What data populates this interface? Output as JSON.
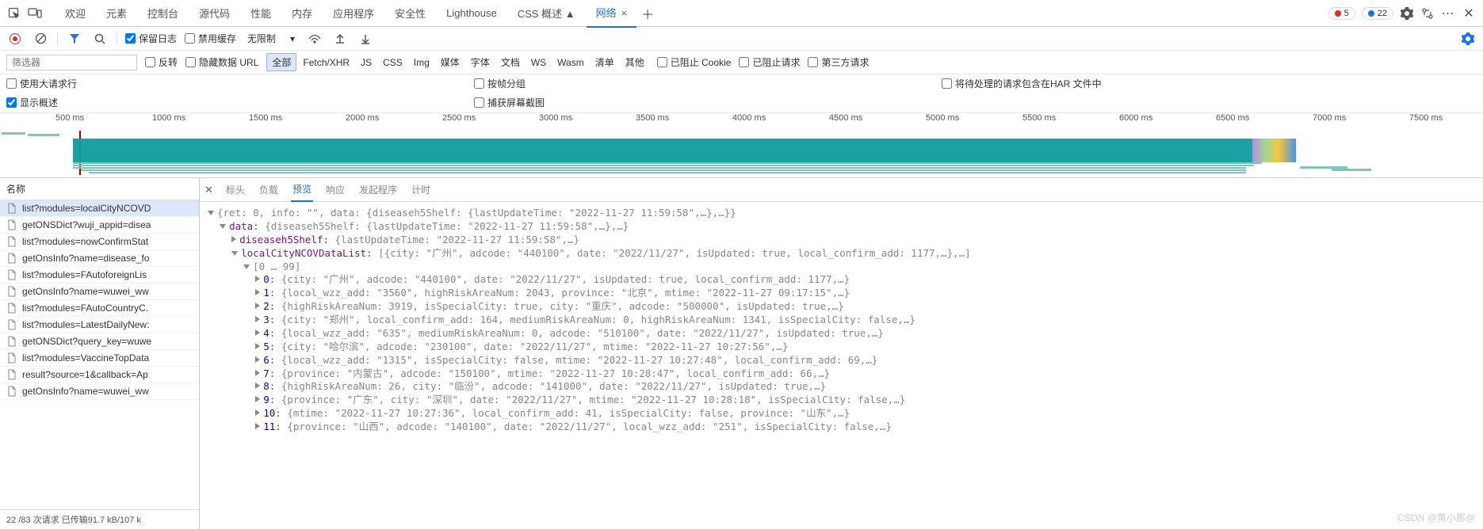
{
  "tabs": [
    "欢迎",
    "元素",
    "控制台",
    "源代码",
    "性能",
    "内存",
    "应用程序",
    "安全性",
    "Lighthouse",
    "CSS 概述 ▲",
    "网络"
  ],
  "activeTab": "网络",
  "errorCount": "5",
  "warnCount": "22",
  "toolbar": {
    "preserveLog": "保留日志",
    "disableCache": "禁用缓存",
    "throttling": "无限制"
  },
  "filter": {
    "placeholder": "筛选器",
    "invert": "反转",
    "hideDataUrl": "隐藏数据 URL",
    "types": [
      "全部",
      "Fetch/XHR",
      "JS",
      "CSS",
      "Img",
      "媒体",
      "字体",
      "文档",
      "WS",
      "Wasm",
      "清单",
      "其他"
    ],
    "blocked3p": "第三方请求",
    "blockedCookies": "已阻止 Cookie",
    "blockedReq": "已阻止请求"
  },
  "opts": {
    "bigRows": "使用大请求行",
    "groupByFrame": "按帧分组",
    "harIncludePending": "将待处理的请求包含在HAR 文件中",
    "showOverview": "显示概述",
    "captureScreens": "捕获屏幕截图"
  },
  "ruler": [
    "500 ms",
    "1000 ms",
    "1500 ms",
    "2000 ms",
    "2500 ms",
    "3000 ms",
    "3500 ms",
    "4000 ms",
    "4500 ms",
    "5000 ms",
    "5500 ms",
    "6000 ms",
    "6500 ms",
    "7000 ms",
    "7500 ms"
  ],
  "left": {
    "header": "名称",
    "items": [
      "list?modules=localCityNCOVD",
      "getONSDict?wuji_appid=disea",
      "list?modules=nowConfirmStat",
      "getOnsInfo?name=disease_fo",
      "list?modules=FAutoforeignLis",
      "getOnsInfo?name=wuwei_ww",
      "list?modules=FAutoCountryC.",
      "list?modules=LatestDailyNew:",
      "getONSDict?query_key=wuwe",
      "list?modules=VaccineTopData",
      "result?source=1&callback=Ap",
      "getOnsInfo?name=wuwei_ww"
    ],
    "status": "22 /83 次请求   已传输91.7 kB/107 k"
  },
  "detailTabs": [
    "标头",
    "负载",
    "预览",
    "响应",
    "发起程序",
    "计时"
  ],
  "activeDetailTab": "预览",
  "preview": {
    "l0": "{ret: 0, info: \"\", data: {diseaseh5Shelf: {lastUpdateTime: \"2022-11-27 11:59:58\",…},…}}",
    "l1_key": "data",
    "l1_val": "{diseaseh5Shelf: {lastUpdateTime: \"2022-11-27 11:59:58\",…},…}",
    "l2_key": "diseaseh5Shelf",
    "l2_val": "{lastUpdateTime: \"2022-11-27 11:59:58\",…}",
    "l3_key": "localCityNCOVDataList",
    "l3_val": "[{city: \"广州\", adcode: \"440100\", date: \"2022/11/27\", isUpdated: true, local_confirm_add: 1177,…},…]",
    "range": "[0 … 99]",
    "items": [
      {
        "i": "0",
        "v": "{city: \"广州\", adcode: \"440100\", date: \"2022/11/27\", isUpdated: true, local_confirm_add: 1177,…}"
      },
      {
        "i": "1",
        "v": "{local_wzz_add: \"3560\", highRiskAreaNum: 2043, province: \"北京\", mtime: \"2022-11-27 09:17:15\",…}"
      },
      {
        "i": "2",
        "v": "{highRiskAreaNum: 3919, isSpecialCity: true, city: \"重庆\", adcode: \"500000\", isUpdated: true,…}"
      },
      {
        "i": "3",
        "v": "{city: \"郑州\", local_confirm_add: 164, mediumRiskAreaNum: 0, highRiskAreaNum: 1341, isSpecialCity: false,…}"
      },
      {
        "i": "4",
        "v": "{local_wzz_add: \"635\", mediumRiskAreaNum: 0, adcode: \"510100\", date: \"2022/11/27\", isUpdated: true,…}"
      },
      {
        "i": "5",
        "v": "{city: \"哈尔滨\", adcode: \"230100\", date: \"2022/11/27\", mtime: \"2022-11-27 10:27:56\",…}"
      },
      {
        "i": "6",
        "v": "{local_wzz_add: \"1315\", isSpecialCity: false, mtime: \"2022-11-27 10:27:48\", local_confirm_add: 69,…}"
      },
      {
        "i": "7",
        "v": "{province: \"内蒙古\", adcode: \"150100\", mtime: \"2022-11-27 10:28:47\", local_confirm_add: 66,…}"
      },
      {
        "i": "8",
        "v": "{highRiskAreaNum: 26, city: \"临汾\", adcode: \"141000\", date: \"2022/11/27\", isUpdated: true,…}"
      },
      {
        "i": "9",
        "v": "{province: \"广东\", city: \"深圳\", date: \"2022/11/27\", mtime: \"2022-11-27 10:28:18\", isSpecialCity: false,…}"
      },
      {
        "i": "10",
        "v": "{mtime: \"2022-11-27 10:27:36\", local_confirm_add: 41, isSpecialCity: false, province: \"山东\",…}"
      },
      {
        "i": "11",
        "v": "{province: \"山西\", adcode: \"140100\", date: \"2022/11/27\", local_wzz_add: \"251\", isSpecialCity: false,…}"
      }
    ]
  },
  "watermark": "CSDN @黄小那@"
}
